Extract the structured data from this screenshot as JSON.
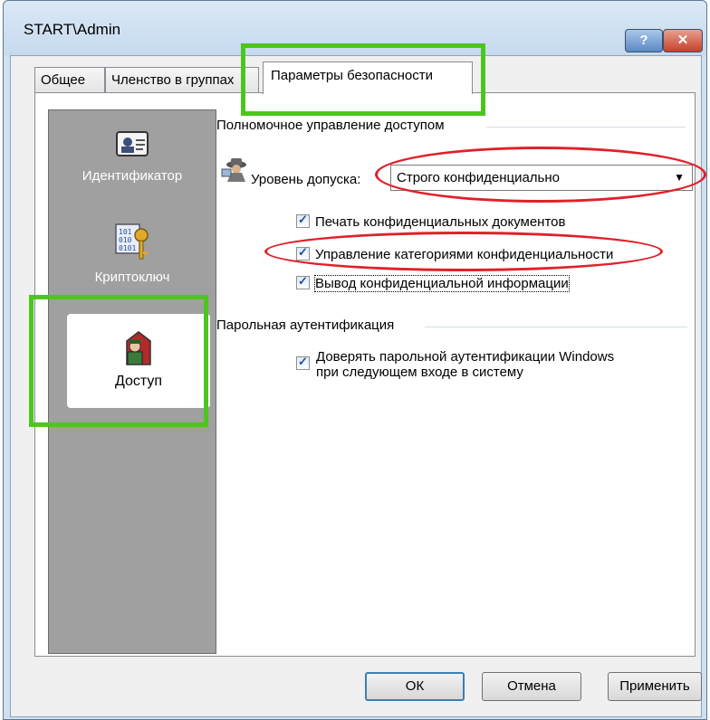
{
  "window": {
    "title": "START\\Admin",
    "help_label": "?",
    "close_label": "x"
  },
  "tabs": [
    {
      "label": "Общее"
    },
    {
      "label": "Членство в группах"
    },
    {
      "label": "Параметры безопасности",
      "selected": true
    }
  ],
  "sidebar": {
    "items": [
      {
        "label": "Идентификатор",
        "icon": "id-card-icon"
      },
      {
        "label": "Криптоключ",
        "icon": "crypto-key-icon"
      },
      {
        "label": "Доступ",
        "icon": "access-guard-icon",
        "selected": true
      }
    ]
  },
  "access": {
    "group_title": "Полномочное управление доступом",
    "level_label": "Уровень допуска:",
    "level_value": "Строго конфиденциально",
    "checkboxes": [
      {
        "label": "Печать конфиденциальных документов",
        "checked": true
      },
      {
        "label": "Управление категориями конфиденциальности",
        "checked": true
      },
      {
        "label": "Вывод конфиденциальной информации",
        "checked": true
      }
    ]
  },
  "password": {
    "group_title": "Парольная аутентификация",
    "checkbox_line1": "Доверять парольной аутентификации Windows",
    "checkbox_line2": "при следующем входе в систему",
    "checked": true
  },
  "buttons": {
    "ok": "ОК",
    "cancel": "Отмена",
    "apply": "Применить"
  },
  "colors": {
    "highlight_green": "#4cc61e",
    "highlight_red": "#e0202a"
  }
}
